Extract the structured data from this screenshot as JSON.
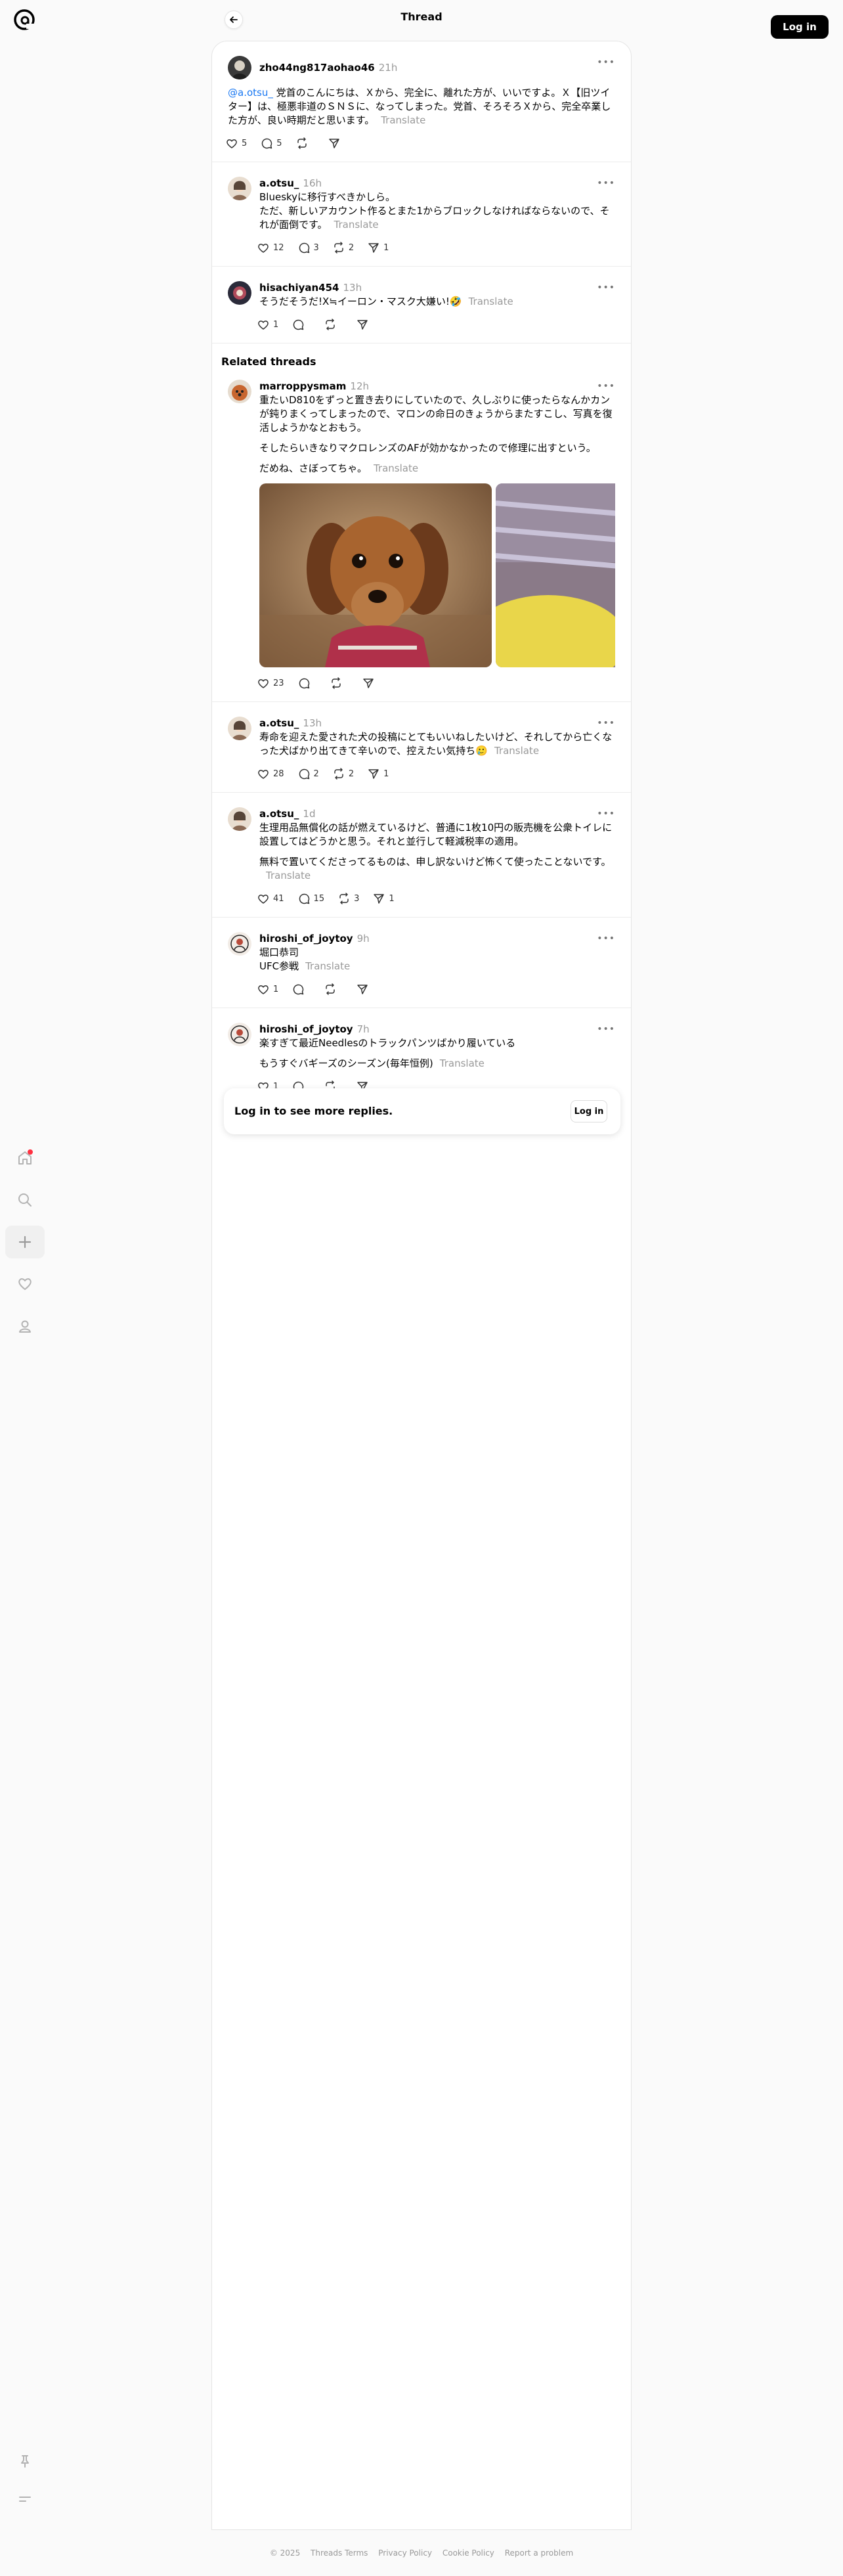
{
  "header": {
    "title": "Thread",
    "login_label": "Log in"
  },
  "nav": {
    "items": [
      "home-icon",
      "search-icon",
      "create-icon",
      "heart-icon",
      "profile-icon"
    ],
    "bottom": [
      "pin-icon",
      "menu-icon"
    ]
  },
  "main_post": {
    "username": "zho44ng817aohao46",
    "time": "21h",
    "mention": "@a.otsu_",
    "text": " 党首のこんにちは、Ｘから、完全に、離れた方が、いいですよ。Ｘ【旧ツイター】は、極悪非道のＳＮＳに、なってしまった。党首、そろそろＸから、完全卒業した方が、良い時期だと思います。",
    "translate": "Translate",
    "likes": "5",
    "replies": "5",
    "reposts": "",
    "shares": ""
  },
  "replies": [
    {
      "username": "a.otsu_",
      "time": "16h",
      "paragraphs": [
        "Blueskyに移行すべきかしら。\nただ、新しいアカウント作るとまた1からブロックしなければならないので、それが面倒です。"
      ],
      "translate": "Translate",
      "likes": "12",
      "replies": "3",
      "reposts": "2",
      "shares": "1"
    },
    {
      "username": "hisachiyan454",
      "time": "13h",
      "paragraphs": [
        "そうだそうだ!X≒イーロン・マスク大嫌い!🤣"
      ],
      "translate": "Translate",
      "likes": "1",
      "replies": "",
      "reposts": "",
      "shares": ""
    }
  ],
  "related": {
    "title": "Related threads",
    "posts": [
      {
        "username": "marroppysmam",
        "time": "12h",
        "paragraphs": [
          "重たいD810をずっと置き去りにしていたので、久しぶりに使ったらなんかカンが鈍りまくってしまったので、マロンの命日のきょうからまたすこし、写真を復活しようかなとおもう。",
          "そしたらいきなりマクロレンズのAFが効かなかったので修理に出すという。",
          "だめね、さぼってちゃ。"
        ],
        "translate": "Translate",
        "photos": [
          "dachshund-photo",
          "dachshund-photo-2"
        ],
        "likes": "23",
        "replies": "",
        "reposts": "",
        "shares": ""
      },
      {
        "username": "a.otsu_",
        "time": "13h",
        "paragraphs": [
          "寿命を迎えた愛された犬の投稿にとてもいいねしたいけど、それしてから亡くなった犬ばかり出てきて辛いので、控えたい気持ち🥲"
        ],
        "translate": "Translate",
        "likes": "28",
        "replies": "2",
        "reposts": "2",
        "shares": "1"
      },
      {
        "username": "a.otsu_",
        "time": "1d",
        "paragraphs": [
          "生理用品無償化の話が燃えているけど、普通に1枚10円の販売機を公衆トイレに設置してはどうかと思う。それと並行して軽減税率の適用。",
          "無料で置いてくださってるものは、申し訳ないけど怖くて使ったことないです。"
        ],
        "translate": "Translate",
        "likes": "41",
        "replies": "15",
        "reposts": "3",
        "shares": "1"
      },
      {
        "username": "hiroshi_of_joytoy",
        "time": "9h",
        "paragraphs": [
          "堀口恭司\nUFC参戦"
        ],
        "translate": "Translate",
        "likes": "1",
        "replies": "",
        "reposts": "",
        "shares": ""
      },
      {
        "username": "hiroshi_of_joytoy",
        "time": "7h",
        "paragraphs": [
          "楽すぎて最近Needlesのトラックパンツばかり履いている",
          "もうすぐバギーズのシーズン(毎年恒例)"
        ],
        "translate": "Translate",
        "likes": "1",
        "replies": "",
        "reposts": "",
        "shares": ""
      }
    ]
  },
  "login_prompt": {
    "text": "Log in to see more replies.",
    "button": "Log in"
  },
  "footer": [
    "© 2025",
    "Threads Terms",
    "Privacy Policy",
    "Cookie Policy",
    "Report a problem"
  ]
}
